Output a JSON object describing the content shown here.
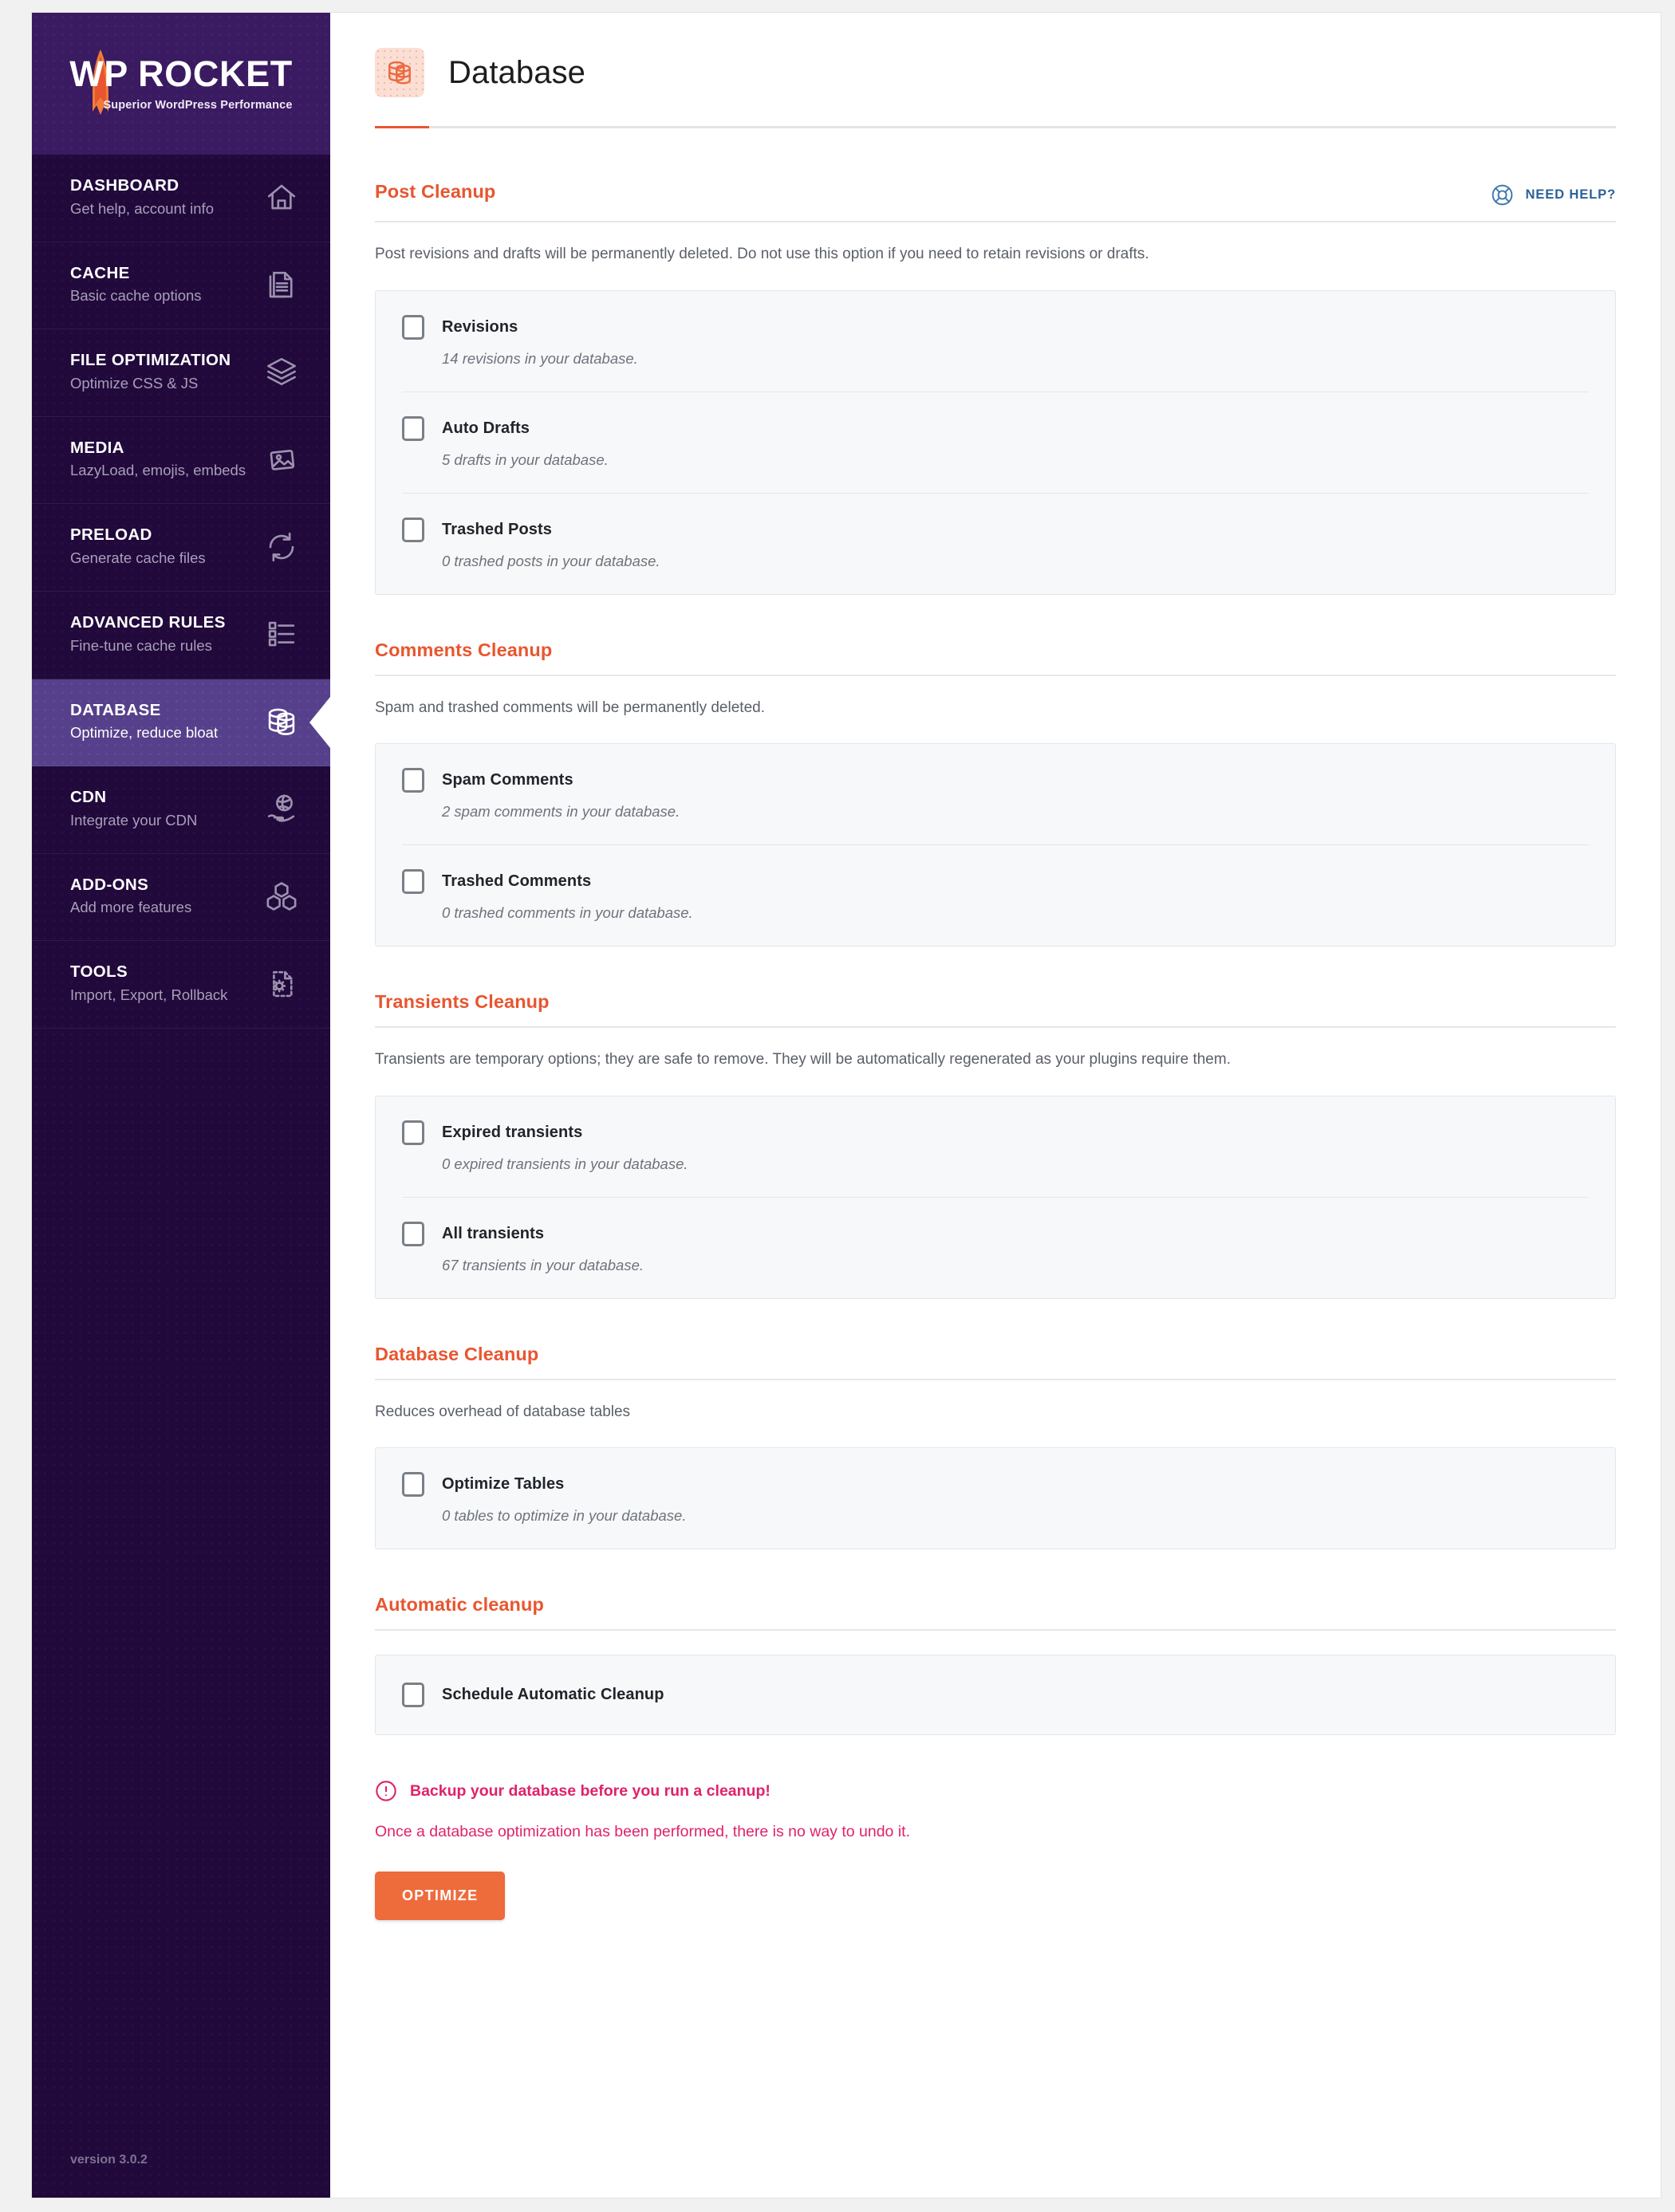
{
  "brand": {
    "name": "WP ROCKET",
    "tagline": "Superior WordPress Performance",
    "version": "version 3.0.2"
  },
  "sidebar": {
    "items": [
      {
        "title": "DASHBOARD",
        "sub": "Get help, account info",
        "icon": "home-icon",
        "active": false
      },
      {
        "title": "CACHE",
        "sub": "Basic cache options",
        "icon": "document-icon",
        "active": false
      },
      {
        "title": "FILE OPTIMIZATION",
        "sub": "Optimize CSS & JS",
        "icon": "layers-icon",
        "active": false
      },
      {
        "title": "MEDIA",
        "sub": "LazyLoad, emojis, embeds",
        "icon": "images-icon",
        "active": false
      },
      {
        "title": "PRELOAD",
        "sub": "Generate cache files",
        "icon": "refresh-icon",
        "active": false
      },
      {
        "title": "ADVANCED RULES",
        "sub": "Fine-tune cache rules",
        "icon": "checklist-icon",
        "active": false
      },
      {
        "title": "DATABASE",
        "sub": "Optimize, reduce bloat",
        "icon": "database-icon",
        "active": true
      },
      {
        "title": "CDN",
        "sub": "Integrate your CDN",
        "icon": "globe-hand-icon",
        "active": false
      },
      {
        "title": "ADD-ONS",
        "sub": "Add more features",
        "icon": "blocks-icon",
        "active": false
      },
      {
        "title": "TOOLS",
        "sub": "Import, Export, Rollback",
        "icon": "file-gear-icon",
        "active": false
      }
    ]
  },
  "header": {
    "title": "Database",
    "icon": "database-icon"
  },
  "need_help": {
    "label": "NEED HELP?",
    "icon": "lifebuoy-icon"
  },
  "sections": [
    {
      "title": "Post Cleanup",
      "desc": "Post revisions and drafts will be permanently deleted. Do not use this option if you need to retain revisions or drafts.",
      "show_need_help": true,
      "options": [
        {
          "label": "Revisions",
          "sub": "14 revisions in your database.",
          "checked": false
        },
        {
          "label": "Auto Drafts",
          "sub": "5 drafts in your database.",
          "checked": false
        },
        {
          "label": "Trashed Posts",
          "sub": "0 trashed posts in your database.",
          "checked": false
        }
      ]
    },
    {
      "title": "Comments Cleanup",
      "desc": "Spam and trashed comments will be permanently deleted.",
      "show_need_help": false,
      "options": [
        {
          "label": "Spam Comments",
          "sub": "2 spam comments in your database.",
          "checked": false
        },
        {
          "label": "Trashed Comments",
          "sub": "0 trashed comments in your database.",
          "checked": false
        }
      ]
    },
    {
      "title": "Transients Cleanup",
      "desc": "Transients are temporary options; they are safe to remove. They will be automatically regenerated as your plugins require them.",
      "show_need_help": false,
      "options": [
        {
          "label": "Expired transients",
          "sub": "0 expired transients in your database.",
          "checked": false
        },
        {
          "label": "All transients",
          "sub": "67 transients in your database.",
          "checked": false
        }
      ]
    },
    {
      "title": "Database Cleanup",
      "desc": "Reduces overhead of database tables",
      "show_need_help": false,
      "options": [
        {
          "label": "Optimize Tables",
          "sub": "0 tables to optimize in your database.",
          "checked": false
        }
      ]
    },
    {
      "title": "Automatic cleanup",
      "desc": "",
      "show_need_help": false,
      "options": [
        {
          "label": "Schedule Automatic Cleanup",
          "sub": "",
          "checked": false
        }
      ]
    }
  ],
  "warning": {
    "icon": "alert-circle-icon",
    "strong": "Backup your database before you run a cleanup!",
    "text": "Once a database optimization has been performed, there is no way to undo it."
  },
  "optimize_button": {
    "label": "OPTIMIZE"
  },
  "colors": {
    "accent_orange": "#e8562f",
    "button_orange": "#ee6b3c",
    "sidebar_purple": "#21093b",
    "sidebar_active": "#56408b",
    "warning_pink": "#e0226a",
    "link_blue": "#2b6298"
  }
}
